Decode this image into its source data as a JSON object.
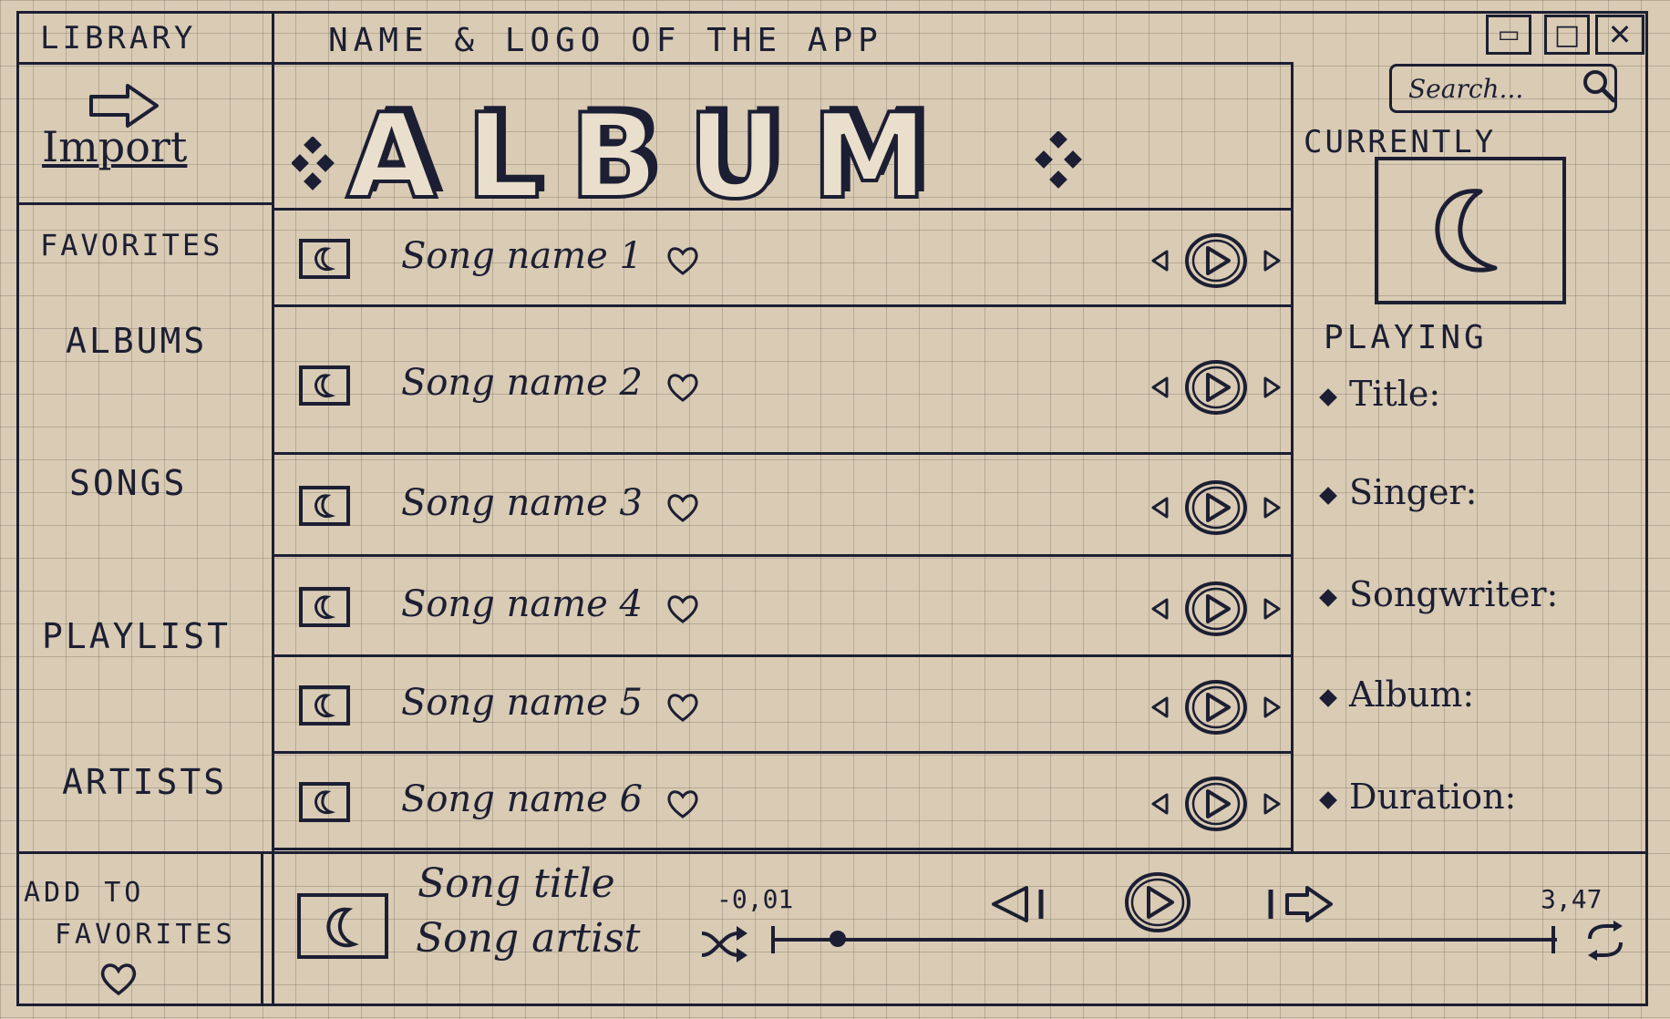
{
  "window": {
    "app_title": "NAME & LOGO OF THE APP",
    "minimize_glyph": "▭",
    "maximize_glyph": "□",
    "close_glyph": "✕"
  },
  "sidebar": {
    "library_label": "LIBRARY",
    "import_label": "Import",
    "items": [
      {
        "label": "FAVORITES"
      },
      {
        "label": "ALBUMS"
      },
      {
        "label": "SONGS"
      },
      {
        "label": "PLAYLIST"
      },
      {
        "label": "ARTISTS"
      }
    ],
    "add_to_favorites_line1": "ADD TO",
    "add_to_favorites_line2": "FAVORITES"
  },
  "main": {
    "album_title": "ALBUM",
    "songs": [
      {
        "name": "Song name 1"
      },
      {
        "name": "Song name 2"
      },
      {
        "name": "Song name 3"
      },
      {
        "name": "Song name 4"
      },
      {
        "name": "Song name 5"
      },
      {
        "name": "Song name 6"
      }
    ]
  },
  "search": {
    "placeholder": "Search..."
  },
  "now_playing": {
    "heading_top": "CURRENTLY",
    "heading_bottom": "PLAYING",
    "fields": [
      {
        "label": "Title:"
      },
      {
        "label": "Singer:"
      },
      {
        "label": "Songwriter:"
      },
      {
        "label": "Album:"
      },
      {
        "label": "Duration:"
      }
    ]
  },
  "player": {
    "song_title": "Song title",
    "song_artist": "Song artist",
    "elapsed": "-0,01",
    "total": "3,47",
    "progress_fraction": 0.05
  },
  "colors": {
    "ink": "#1c1f33",
    "paper": "#d9cbb4"
  }
}
